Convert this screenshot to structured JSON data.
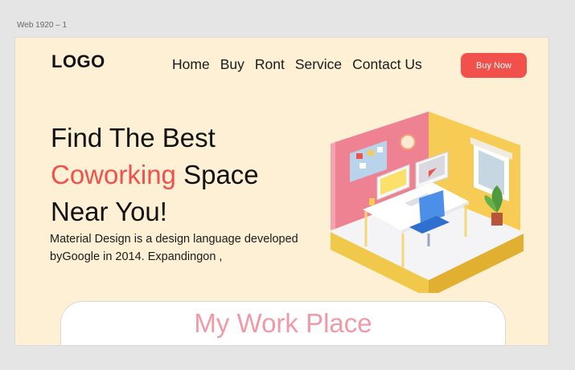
{
  "frame": {
    "label": "Web 1920 – 1"
  },
  "header": {
    "logo": "LOGO",
    "nav": [
      {
        "label": "Home"
      },
      {
        "label": "Buy"
      },
      {
        "label": "Ront"
      },
      {
        "label": "Service"
      },
      {
        "label": "Contact Us"
      }
    ],
    "cta_label": "Buy Now"
  },
  "hero": {
    "title_line1": "Find The Best",
    "title_accent": "Coworking",
    "title_line2_rest": " Space",
    "title_line3": "Near You!",
    "description": "Material Design is a design language developed byGoogle in 2014. Expandingon ,"
  },
  "section": {
    "title": "My Work Place"
  },
  "colors": {
    "page_bg": "#fef0d5",
    "accent": "#f2504a",
    "section_title": "#f09aa8",
    "canvas_bg": "#e5e5e5"
  },
  "icons": {
    "hero_image": "isometric-office-room-illustration"
  }
}
